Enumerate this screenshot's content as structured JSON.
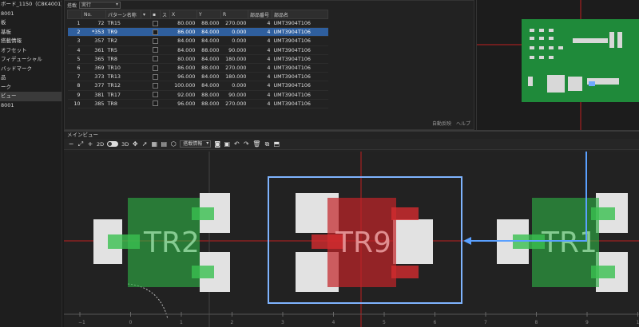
{
  "tree": {
    "items": [
      {
        "label": "ボード_1150（C8K4001）",
        "selected": false
      },
      {
        "label": "8001",
        "selected": false
      },
      {
        "label": "板",
        "selected": false
      },
      {
        "label": "基板",
        "selected": false
      },
      {
        "label": "搭載情報",
        "selected": false
      },
      {
        "label": "オフセット",
        "selected": false
      },
      {
        "label": "フィデューシャル",
        "selected": false
      },
      {
        "label": "バッドマーク",
        "selected": false
      },
      {
        "label": "品",
        "selected": false
      },
      {
        "label": "ーク",
        "selected": false
      },
      {
        "label": "ビュー",
        "selected": true
      },
      {
        "label": "8001",
        "selected": false
      }
    ]
  },
  "table": {
    "mode_label": "搭載",
    "mode_value": "実行",
    "headers": [
      "",
      "No.",
      "パターン名称",
      "",
      "",
      "ス",
      "X",
      "Y",
      "R",
      "部品番号",
      "部品名"
    ],
    "rows": [
      [
        "1",
        "72",
        "TR15",
        "",
        "",
        "",
        "80.000",
        "88.000",
        "270.000",
        "4",
        "UMT3904T106"
      ],
      [
        "2",
        "*353",
        "TR9",
        "",
        "",
        "",
        "86.000",
        "84.000",
        "0.000",
        "4",
        "UMT3904T106"
      ],
      [
        "3",
        "357",
        "TR2",
        "",
        "",
        "",
        "84.000",
        "84.000",
        "0.000",
        "4",
        "UMT3904T106"
      ],
      [
        "4",
        "361",
        "TR5",
        "",
        "",
        "",
        "84.000",
        "88.000",
        "90.000",
        "4",
        "UMT3904T106"
      ],
      [
        "5",
        "365",
        "TR8",
        "",
        "",
        "",
        "80.000",
        "84.000",
        "180.000",
        "4",
        "UMT3904T106"
      ],
      [
        "6",
        "369",
        "TR10",
        "",
        "",
        "",
        "86.000",
        "88.000",
        "270.000",
        "4",
        "UMT3904T106"
      ],
      [
        "7",
        "373",
        "TR13",
        "",
        "",
        "",
        "96.000",
        "84.000",
        "180.000",
        "4",
        "UMT3904T106"
      ],
      [
        "8",
        "377",
        "TR12",
        "",
        "",
        "",
        "100.000",
        "84.000",
        "0.000",
        "4",
        "UMT3904T106"
      ],
      [
        "9",
        "381",
        "TR17",
        "",
        "",
        "",
        "92.000",
        "88.000",
        "90.000",
        "4",
        "UMT3904T106"
      ],
      [
        "10",
        "385",
        "TR8",
        "",
        "",
        "",
        "96.000",
        "88.000",
        "270.000",
        "4",
        "UMT3904T106"
      ]
    ],
    "selected_row": 1,
    "footer": [
      "自動反映",
      "ヘルプ"
    ]
  },
  "mainview": {
    "title": "メインビュー",
    "label_2d": "2D",
    "label_3d": "3D",
    "dropdown": "搭載情報",
    "components": [
      {
        "label": "TR2",
        "color": "#2eaa44"
      },
      {
        "label": "TR9",
        "color": "#c32428"
      },
      {
        "label": "TR1",
        "color": "#2eaa44"
      }
    ],
    "ruler_labels": [
      "−1",
      "0",
      "1",
      "2",
      "3",
      "4",
      "5",
      "6",
      "7",
      "8",
      "9",
      "10"
    ]
  },
  "colors": {
    "selection": "#2f5f9e",
    "highlight_frame": "#7fb4ff",
    "crosshair": "#e02020"
  }
}
